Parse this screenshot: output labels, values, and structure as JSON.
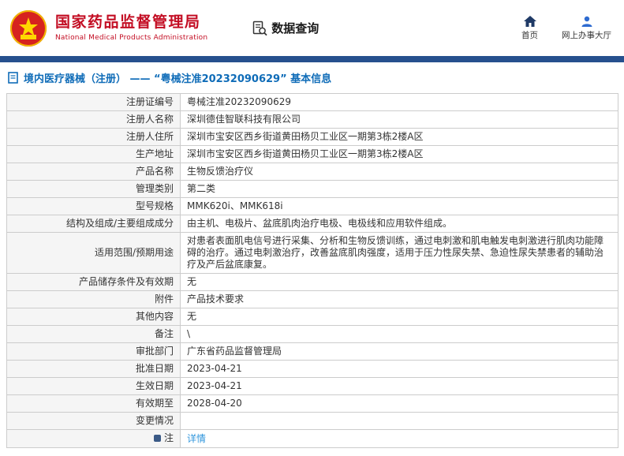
{
  "header": {
    "org_name_cn": "国家药品监督管理局",
    "org_name_en": "National Medical Products Administration",
    "nav_query": "数据查询",
    "links": {
      "home": "首页",
      "hall": "网上办事大厅"
    }
  },
  "colors": {
    "brand_red": "#c30d23",
    "bar_blue": "#26508e",
    "title_blue": "#0f6cb8",
    "link_blue": "#3096dc",
    "label_bg": "#f5f5f5",
    "border_gray": "#cccccc"
  },
  "breadcrumb": {
    "text": "境内医疗器械（注册） —— “粤械注准20232090629” 基本信息"
  },
  "table": {
    "rows": [
      {
        "label": "注册证编号",
        "value": "粤械注准20232090629"
      },
      {
        "label": "注册人名称",
        "value": "深圳德佳智联科技有限公司"
      },
      {
        "label": "注册人住所",
        "value": "深圳市宝安区西乡街道黄田杨贝工业区一期第3栋2楼A区"
      },
      {
        "label": "生产地址",
        "value": "深圳市宝安区西乡街道黄田杨贝工业区一期第3栋2楼A区"
      },
      {
        "label": "产品名称",
        "value": "生物反馈治疗仪"
      },
      {
        "label": "管理类别",
        "value": "第二类"
      },
      {
        "label": "型号规格",
        "value": "MMK620i、MMK618i"
      },
      {
        "label": "结构及组成/主要组成成分",
        "value": "由主机、电极片、盆底肌肉治疗电极、电极线和应用软件组成。"
      },
      {
        "label": "适用范围/预期用途",
        "value": "对患者表面肌电信号进行采集、分析和生物反馈训练，通过电刺激和肌电触发电刺激进行肌肉功能障碍的治疗。通过电刺激治疗，改善盆底肌肉强度，适用于压力性尿失禁、急迫性尿失禁患者的辅助治疗及产后盆底康复。"
      },
      {
        "label": "产品储存条件及有效期",
        "value": "无"
      },
      {
        "label": "附件",
        "value": "产品技术要求"
      },
      {
        "label": "其他内容",
        "value": "无"
      },
      {
        "label": "备注",
        "value": "\\"
      },
      {
        "label": "审批部门",
        "value": "广东省药品监督管理局"
      },
      {
        "label": "批准日期",
        "value": "2023-04-21"
      },
      {
        "label": "生效日期",
        "value": "2023-04-21"
      },
      {
        "label": "有效期至",
        "value": "2028-04-20"
      },
      {
        "label": "变更情况",
        "value": ""
      },
      {
        "label": "注",
        "value": "详情"
      }
    ]
  }
}
